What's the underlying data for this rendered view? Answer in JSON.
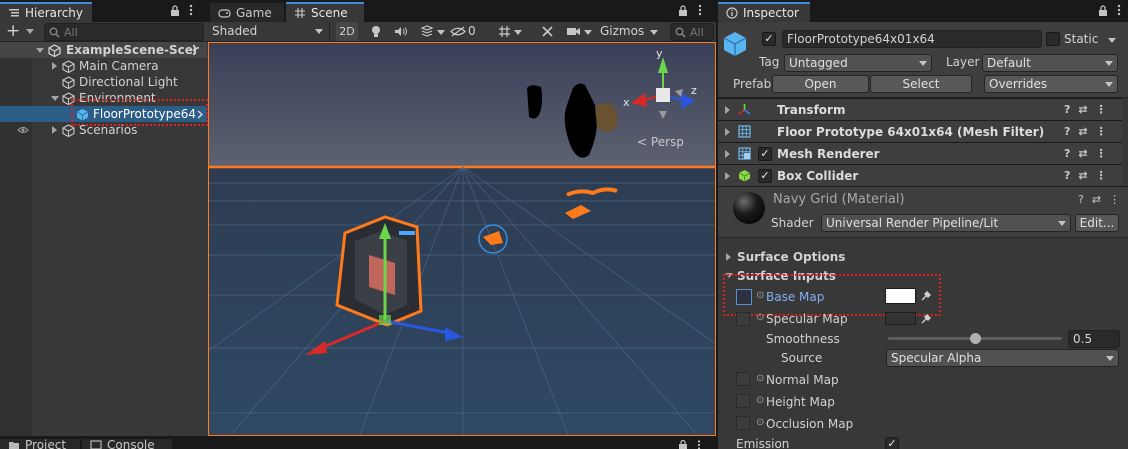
{
  "hierarchy": {
    "tab_label": "Hierarchy",
    "search_placeholder": "All",
    "add_label": "+",
    "items": [
      {
        "label": "ExampleScene-Scer",
        "depth": 0,
        "expanded": true,
        "type": "scene"
      },
      {
        "label": "Main Camera",
        "depth": 1,
        "expanded": false,
        "type": "gameobject"
      },
      {
        "label": "Directional Light",
        "depth": 1,
        "expanded": false,
        "type": "gameobject"
      },
      {
        "label": "Environment",
        "depth": 1,
        "expanded": true,
        "type": "gameobject"
      },
      {
        "label": "FloorPrototype64",
        "depth": 2,
        "expanded": false,
        "type": "prefab",
        "selected": true
      },
      {
        "label": "Scenarios",
        "depth": 1,
        "expanded": false,
        "type": "gameobject"
      }
    ]
  },
  "scene_view": {
    "tabs": [
      {
        "label": "Game",
        "active": false
      },
      {
        "label": "Scene",
        "active": true
      }
    ],
    "shading_mode": "Shaded",
    "mode_2d": "2D",
    "hidden_count": "0",
    "gizmos_label": "Gizmos",
    "search_placeholder": "All",
    "persp_label": "Persp",
    "axis_labels": {
      "x": "x",
      "y": "y",
      "z": "z"
    }
  },
  "bottom_tabs": [
    {
      "label": "Project"
    },
    {
      "label": "Console"
    }
  ],
  "inspector": {
    "tab_label": "Inspector",
    "object_name": "FloorPrototype64x01x64",
    "static_label": "Static",
    "tag_label": "Tag",
    "tag_value": "Untagged",
    "layer_label": "Layer",
    "layer_value": "Default",
    "prefab_label": "Prefab",
    "open_label": "Open",
    "select_label": "Select",
    "overrides_label": "Overrides",
    "components": [
      {
        "label": "Transform",
        "has_checkbox": false,
        "icon": "transform-icon"
      },
      {
        "label": "Floor Prototype 64x01x64 (Mesh Filter)",
        "has_checkbox": false,
        "icon": "mesh-filter-icon"
      },
      {
        "label": "Mesh Renderer",
        "has_checkbox": true,
        "icon": "mesh-renderer-icon"
      },
      {
        "label": "Box Collider",
        "has_checkbox": true,
        "icon": "box-collider-icon"
      }
    ],
    "material": {
      "name": "Navy Grid (Material)",
      "shader_label": "Shader",
      "shader_value": "Universal Render Pipeline/Lit",
      "edit_label": "Edit..."
    },
    "surface_options_label": "Surface Options",
    "surface_inputs_label": "Surface Inputs",
    "base_map_label": "Base Map",
    "base_map_color": "#ffffff",
    "specular_map_label": "Specular Map",
    "smoothness_label": "Smoothness",
    "smoothness_value": "0.5",
    "smoothness_level": 0.5,
    "source_label": "Source",
    "source_value": "Specular Alpha",
    "normal_map_label": "Normal Map",
    "height_map_label": "Height Map",
    "occlusion_map_label": "Occlusion Map",
    "emission_label": "Emission"
  },
  "colors": {
    "highlight": "#e02020",
    "selection": "#2c5d87",
    "accent": "#3d8ede",
    "orange_outline": "#ff7a1a"
  }
}
